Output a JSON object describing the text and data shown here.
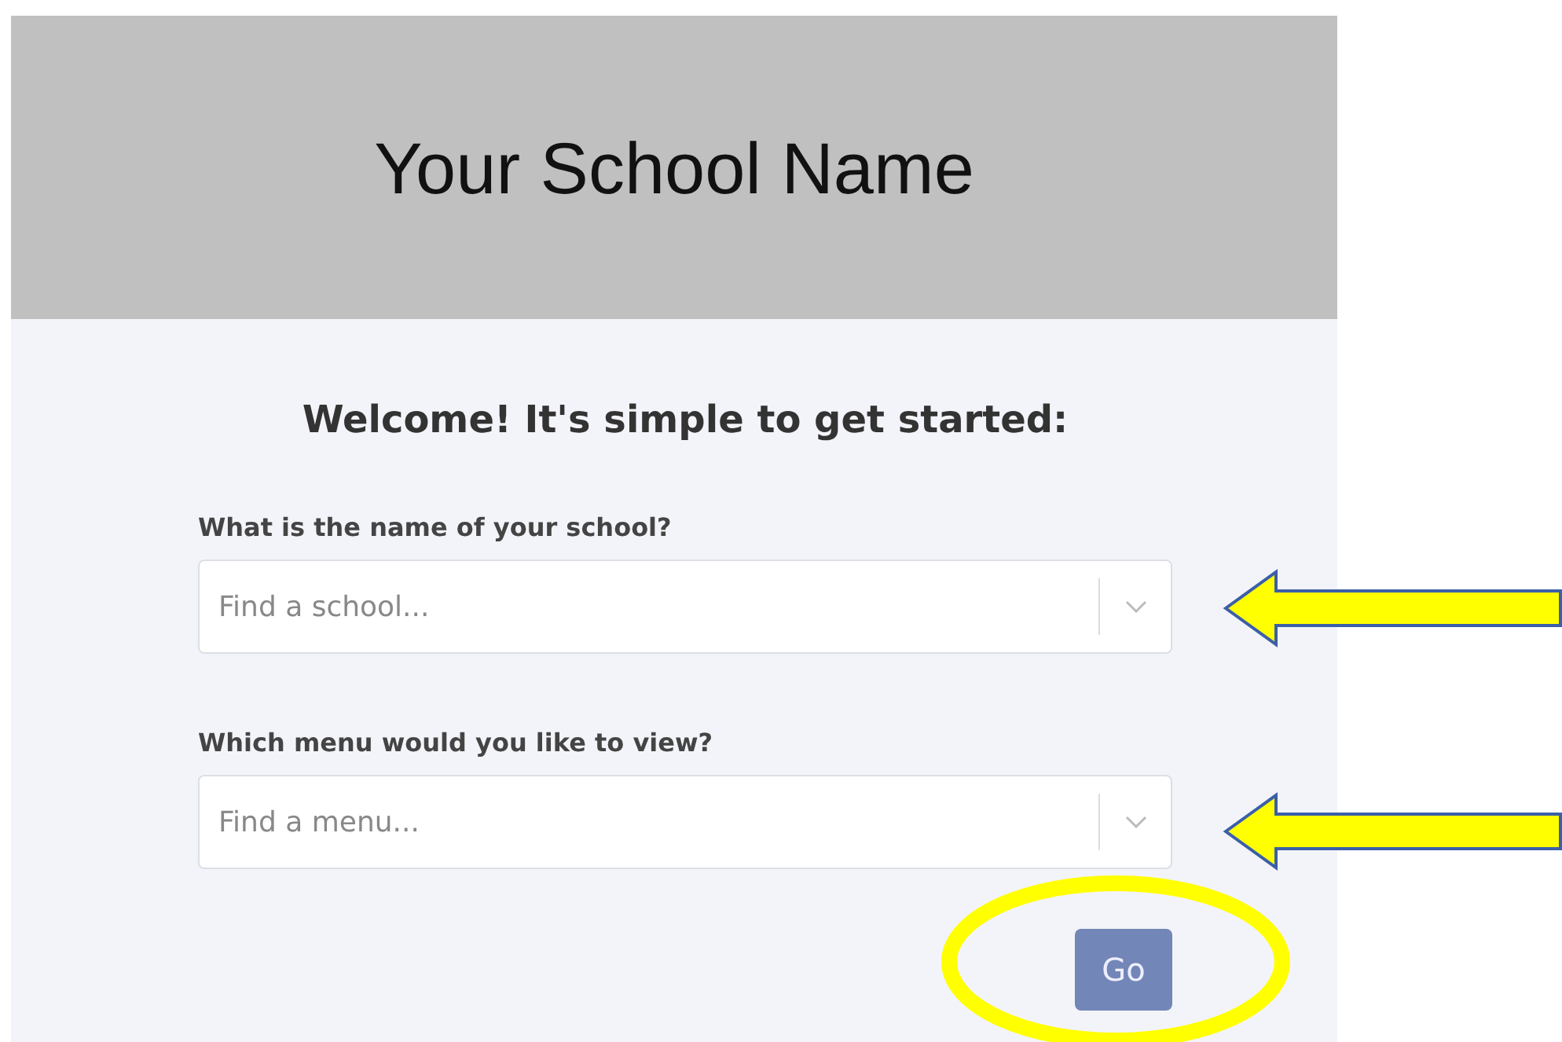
{
  "header": {
    "title": "Your School Name"
  },
  "heading": "Welcome! It's simple to get started:",
  "fields": [
    {
      "label": "What is the name of your school?",
      "placeholder": "Find a school..."
    },
    {
      "label": "Which menu would you like to view?",
      "placeholder": "Find a menu..."
    }
  ],
  "button": {
    "label": "Go"
  }
}
